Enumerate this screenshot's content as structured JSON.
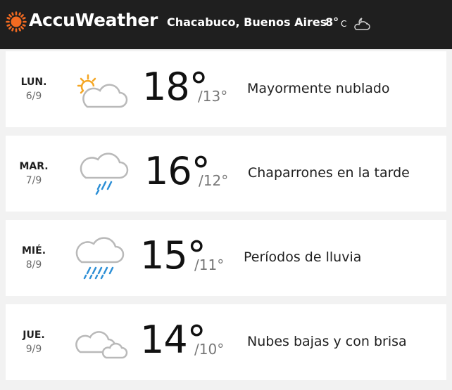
{
  "header": {
    "brand": "AccuWeather",
    "location": "Chacabuco, Buenos Aires",
    "current_temp": "8°",
    "current_unit": "C",
    "current_icon": "partly-cloudy-night-icon",
    "logo_icon": "sun-logo-icon",
    "brand_color": "#f26a21"
  },
  "forecast": [
    {
      "day": "LUN.",
      "date": "6/9",
      "high": "18°",
      "low": "/13°",
      "description": "Mayormente nublado",
      "icon": "partly-sunny-cloud-icon"
    },
    {
      "day": "MAR.",
      "date": "7/9",
      "high": "16°",
      "low": "/12°",
      "description": "Chaparrones en la tarde",
      "icon": "rain-showers-icon"
    },
    {
      "day": "MIÉ.",
      "date": "8/9",
      "high": "15°",
      "low": "/11°",
      "description": "Períodos de lluvia",
      "icon": "rain-icon"
    },
    {
      "day": "JUE.",
      "date": "9/9",
      "high": "14°",
      "low": "/10°",
      "description": "Nubes bajas y con brisa",
      "icon": "clouds-icon"
    }
  ]
}
